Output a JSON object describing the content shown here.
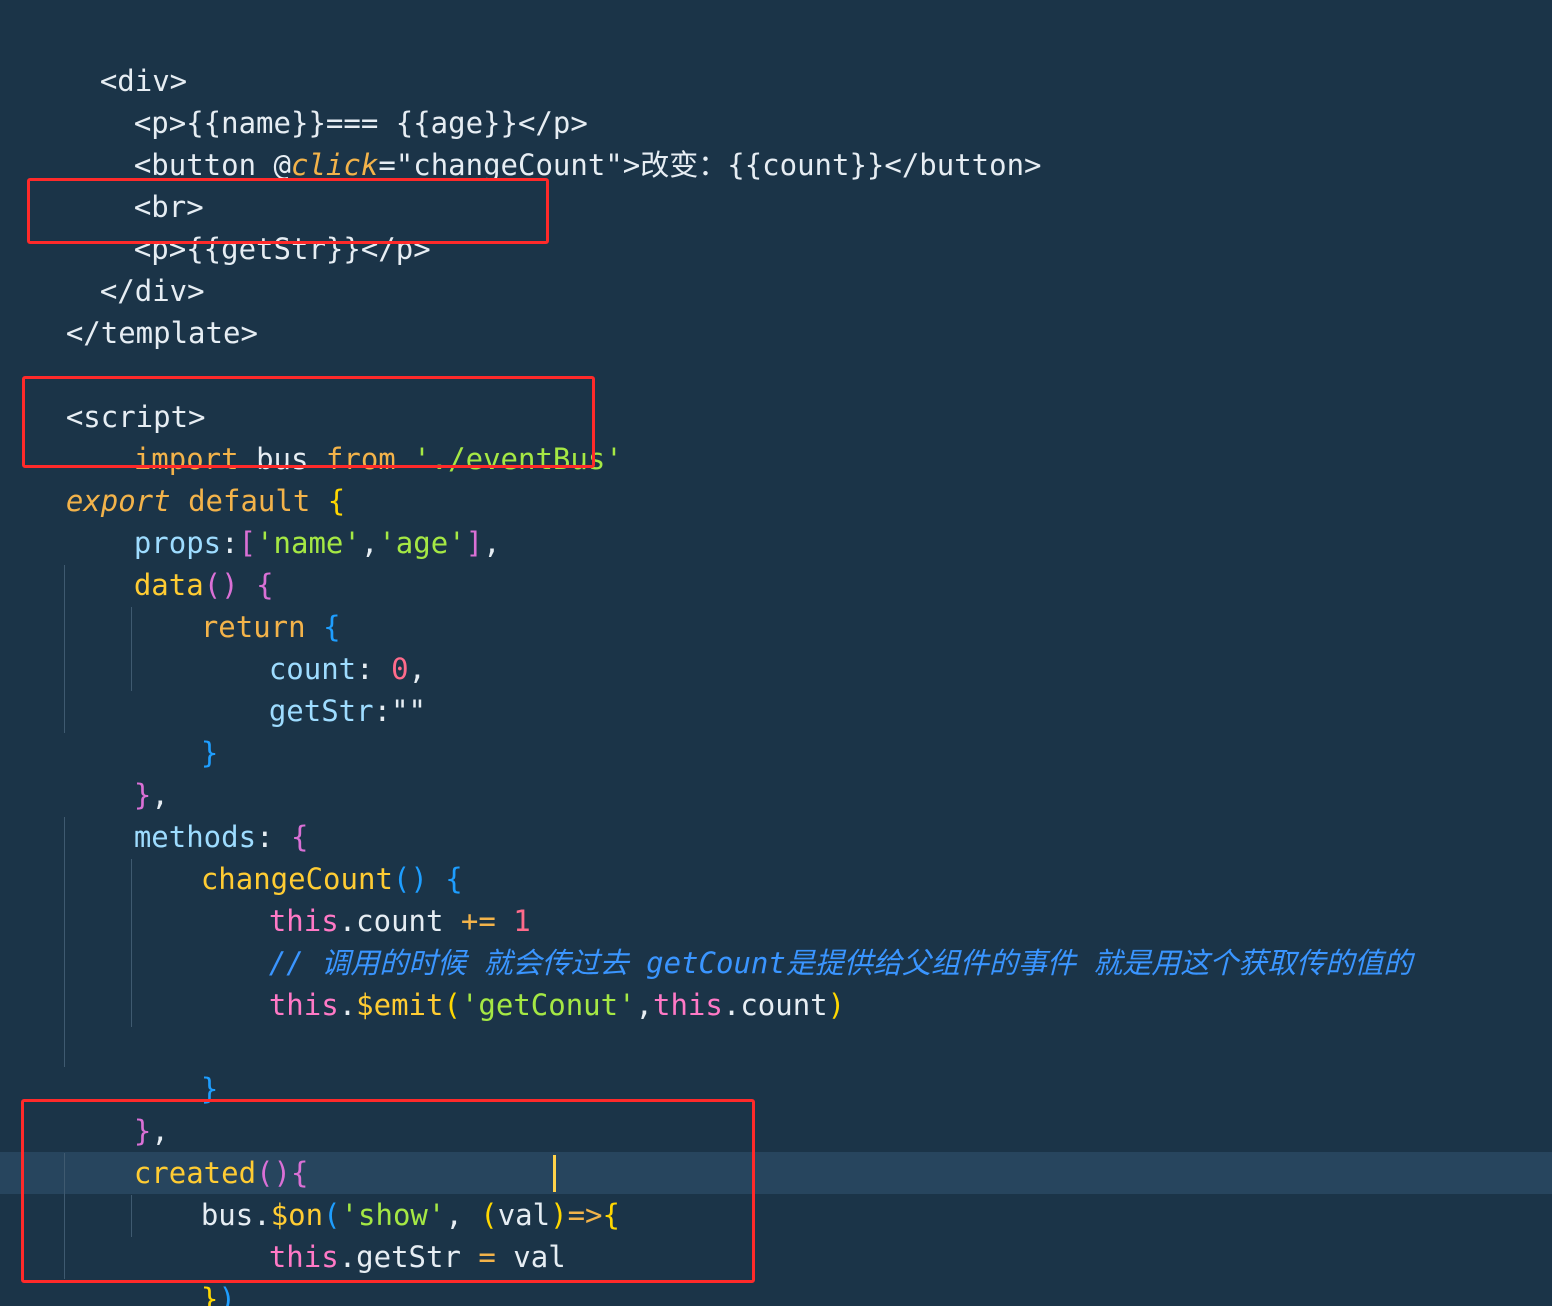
{
  "editor": {
    "language": "vue",
    "cursor_line": 28,
    "highlight_colors": {
      "background": "#1b3448",
      "current_line": "#27455e",
      "annotation_box": "#ff2a2a"
    }
  },
  "code": {
    "l1": {
      "t1": "<div>"
    },
    "l2": {
      "t1": "<p>{{name}}=== {{age}}</p>"
    },
    "l3": {
      "t1": "<button ",
      "t2": "@",
      "t3": "click",
      "t4": "=\"changeCount\">",
      "t5": "改变：",
      "t6": "{{count}}</button>"
    },
    "l4": {
      "t1": "<br>"
    },
    "l5": {
      "t1": "<p>{{getStr}}</p>"
    },
    "l6": {
      "t1": "</div>"
    },
    "l7": {
      "t1": "</template>"
    },
    "l9": {
      "t1": "<script>"
    },
    "l10": {
      "t1": "import",
      "t2": " bus ",
      "t3": "from",
      "t4": " './eventBus'"
    },
    "l11": {
      "t1": "export",
      "t2": " default",
      "t3": " {"
    },
    "l12": {
      "t1": "props",
      "t2": ":",
      "t3": "[",
      "t4": "'name'",
      "t5": ",",
      "t6": "'age'",
      "t7": "]",
      "t8": ","
    },
    "l13": {
      "t1": "data",
      "t2": "()",
      "t3": " {"
    },
    "l14": {
      "t1": "return",
      "t2": " {"
    },
    "l15": {
      "t1": "count",
      "t2": ": ",
      "t3": "0",
      "t4": ","
    },
    "l16": {
      "t1": "getStr",
      "t2": ":",
      "t3": "\"\""
    },
    "l17": {
      "t1": "}"
    },
    "l18": {
      "t1": "}",
      "t2": ","
    },
    "l19": {
      "t1": "methods",
      "t2": ": ",
      "t3": "{"
    },
    "l20": {
      "t1": "changeCount",
      "t2": "()",
      "t3": " {"
    },
    "l21": {
      "t1": "this",
      "t2": ".count ",
      "t3": "+=",
      "t4": " 1"
    },
    "l22": {
      "t1": "// 调用的时候 就会传过去 getCount是提供给父组件的事件 就是用这个获取传的值的"
    },
    "l23": {
      "t1": "this",
      "t2": ".",
      "t3": "$emit",
      "t4": "(",
      "t5": "'getConut'",
      "t6": ",",
      "t7": "this",
      "t8": ".count",
      "t9": ")"
    },
    "l25": {
      "t1": "}"
    },
    "l26": {
      "t1": "}",
      "t2": ","
    },
    "l27": {
      "t1": "created",
      "t2": "()",
      "t3": "{"
    },
    "l28": {
      "t1": "bus",
      "t2": ".",
      "t3": "$on",
      "t4": "(",
      "t5": "'show'",
      "t6": ", ",
      "t7": "(",
      "t8": "val",
      "t9": ")",
      "t10": "=>",
      "t11": "{"
    },
    "l29": {
      "t1": "this",
      "t2": ".getStr ",
      "t3": "=",
      "t4": " val"
    },
    "l30": {
      "t1": "}",
      "t2": ")"
    },
    "l31": {
      "t1": "}"
    }
  }
}
